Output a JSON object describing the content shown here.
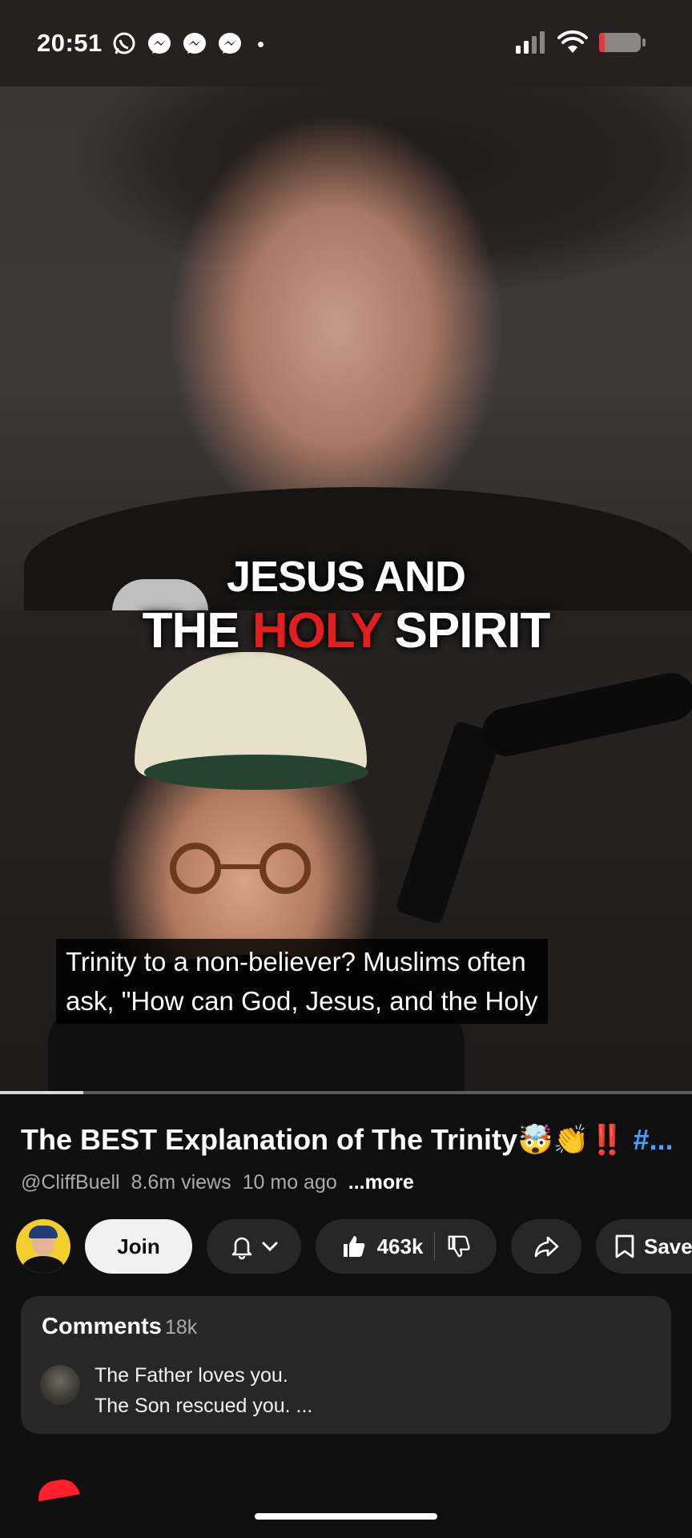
{
  "status_bar": {
    "time": "20:51",
    "notification_icons": [
      "whatsapp-icon",
      "messenger-icon",
      "messenger-icon",
      "messenger-icon",
      "dot-icon"
    ],
    "system_icons": [
      "cellular-signal-icon",
      "wifi-icon",
      "battery-icon"
    ],
    "battery_level": 0.12
  },
  "video": {
    "overlay_line1": "JESUS AND",
    "overlay_line2_pre": "THE ",
    "overlay_line2_highlight": "HOLY",
    "overlay_line2_post": " SPIRIT",
    "highlight_color": "#e31e1e",
    "captions": [
      "Trinity to a non-believer? Muslims often",
      "ask, \"How can God, Jesus, and the Holy"
    ],
    "progress": 0.12
  },
  "details": {
    "title": "The BEST Explanation of The Trinity🤯👏‼️",
    "hashtag": "#...",
    "channel": "@CliffBuell",
    "views": "8.6m views",
    "age": "10 mo ago",
    "more_label": "...more"
  },
  "actions": {
    "join_label": "Join",
    "like_count": "463k",
    "save_label": "Save"
  },
  "comments": {
    "label": "Comments",
    "count": "18k",
    "preview_line1": "The Father loves you.",
    "preview_line2": "The Son rescued you. ..."
  },
  "colors": {
    "background": "#0f0f0f",
    "card": "#272727",
    "link": "#3ea6ff",
    "secondary_text": "#aaaaaa"
  }
}
